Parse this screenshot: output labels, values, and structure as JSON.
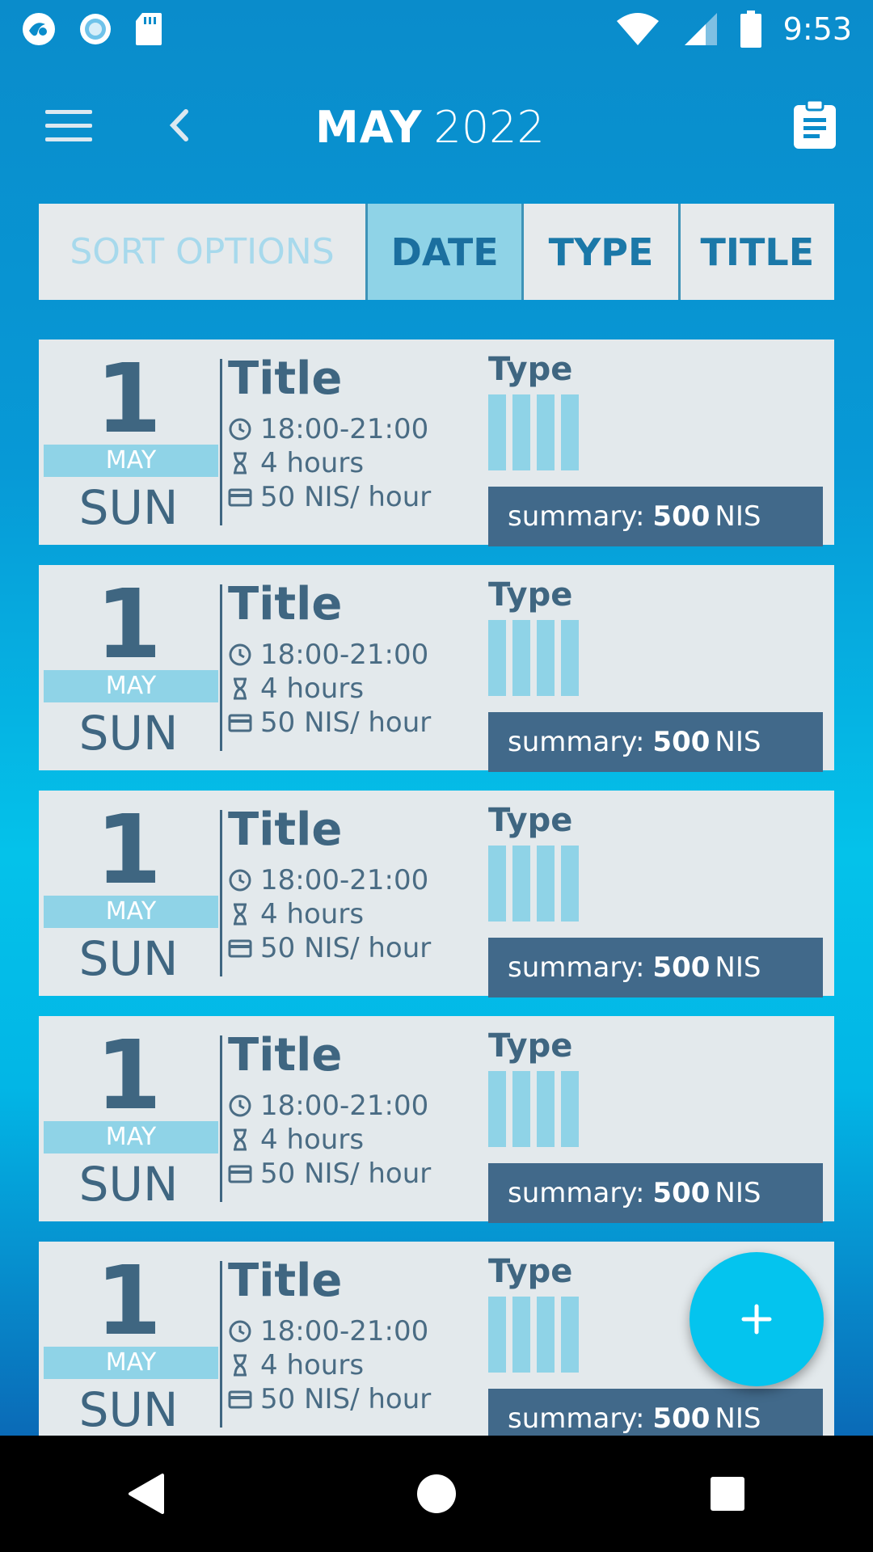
{
  "status_bar": {
    "time": "9:53",
    "left_icons": [
      "app-notification-icon",
      "record-icon",
      "sd-card-icon"
    ],
    "right_icons": [
      "wifi-icon",
      "cell-signal-icon",
      "battery-icon"
    ]
  },
  "app_bar": {
    "month": "MAY",
    "year": "2022",
    "icons": [
      "menu-icon",
      "chevron-left-icon",
      "clipboard-icon"
    ]
  },
  "sort": {
    "label": "SORT OPTIONS",
    "options": [
      {
        "label": "DATE",
        "active": true
      },
      {
        "label": "TYPE",
        "active": false
      },
      {
        "label": "TITLE",
        "active": false
      }
    ]
  },
  "entries": [
    {
      "day": "1",
      "month": "MAY",
      "weekday": "SUN",
      "title": "Title",
      "time": "18:00-21:00",
      "duration": "4 hours",
      "rate": "50 NIS/ hour",
      "type_label": "Type",
      "summary_label": "summary:",
      "summary_value": "500",
      "summary_currency": "NIS"
    },
    {
      "day": "1",
      "month": "MAY",
      "weekday": "SUN",
      "title": "Title",
      "time": "18:00-21:00",
      "duration": "4 hours",
      "rate": "50 NIS/ hour",
      "type_label": "Type",
      "summary_label": "summary:",
      "summary_value": "500",
      "summary_currency": "NIS"
    },
    {
      "day": "1",
      "month": "MAY",
      "weekday": "SUN",
      "title": "Title",
      "time": "18:00-21:00",
      "duration": "4 hours",
      "rate": "50 NIS/ hour",
      "type_label": "Type",
      "summary_label": "summary:",
      "summary_value": "500",
      "summary_currency": "NIS"
    },
    {
      "day": "1",
      "month": "MAY",
      "weekday": "SUN",
      "title": "Title",
      "time": "18:00-21:00",
      "duration": "4 hours",
      "rate": "50 NIS/ hour",
      "type_label": "Type",
      "summary_label": "summary:",
      "summary_value": "500",
      "summary_currency": "NIS"
    },
    {
      "day": "1",
      "month": "MAY",
      "weekday": "SUN",
      "title": "Title",
      "time": "18:00-21:00",
      "duration": "4 hours",
      "rate": "50 NIS/ hour",
      "type_label": "Type",
      "summary_label": "summary:",
      "summary_value": "500",
      "summary_currency": "NIS"
    }
  ],
  "fab": {
    "icon": "plus-icon"
  },
  "nav_bar": {
    "icons": [
      "back-triangle-icon",
      "home-circle-icon",
      "recents-square-icon"
    ]
  },
  "colors": {
    "accent": "#04c4ee",
    "card_bg": "#e3e9ec",
    "tab_active": "#8fd3e7",
    "summary_bg": "#41698a",
    "text_dark": "#3f6681"
  }
}
